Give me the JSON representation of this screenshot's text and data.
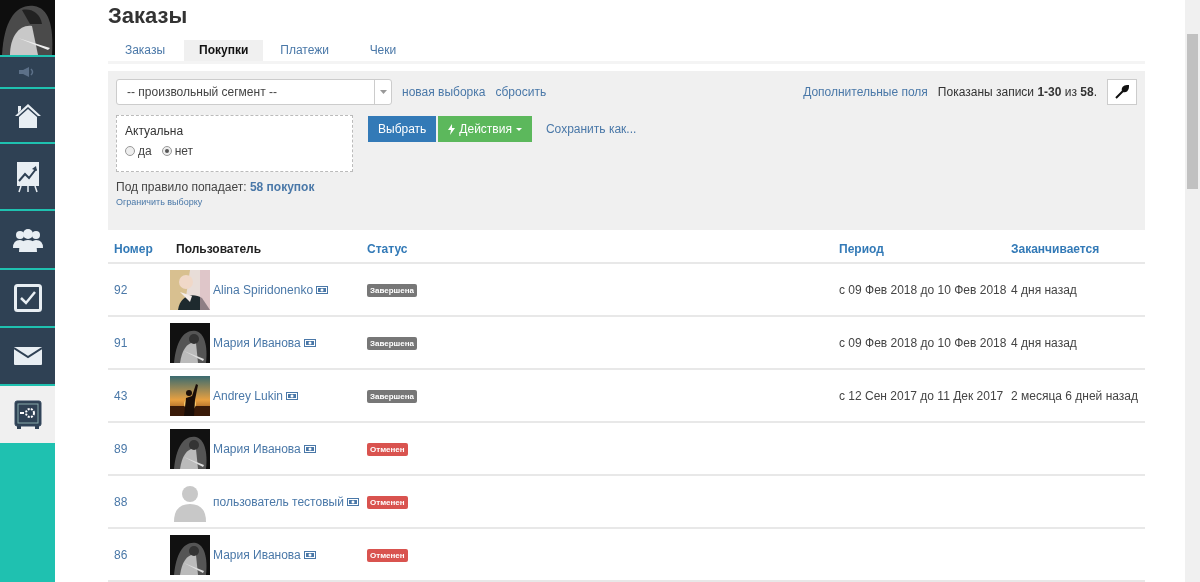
{
  "sidebar": {
    "items": [
      {
        "selected": false
      },
      {
        "selected": false
      },
      {
        "selected": false
      },
      {
        "selected": false
      },
      {
        "selected": false
      },
      {
        "selected": false
      },
      {
        "selected": true
      }
    ]
  },
  "title": "Заказы",
  "tabs": [
    {
      "label": "Заказы",
      "selected": false
    },
    {
      "label": "Покупки",
      "selected": true
    },
    {
      "label": "Платежи",
      "selected": false
    },
    {
      "label": "Чеки",
      "selected": false
    }
  ],
  "filter": {
    "segment_select": {
      "value": "-- произвольный сегмент --"
    },
    "links": [
      "новая выборка",
      "сбросить"
    ],
    "extra_fields_link": "Дополнительные поля",
    "records_info": "Показаны записи **1-30** из **58**.",
    "condition": {
      "label": "Актуальна",
      "options": [
        {
          "label": "да",
          "selected": false
        },
        {
          "label": "нет",
          "selected": true
        }
      ]
    },
    "select_button": "Выбрать",
    "actions_button": "Действия",
    "save_link": "Сохранить как...",
    "rule_info": {
      "text": "Под правило попадает:",
      "link": "58 покупок"
    },
    "limit_link": "Ограничить выборку"
  },
  "table": {
    "columns": [
      "Номер",
      "Пользователь",
      "Статус",
      "Период",
      "Заканчивается"
    ],
    "rows": [
      {
        "number": "92",
        "user": "Alina Spiridonenko",
        "status": "Завершена",
        "color": "#777777",
        "period": "с 09 Фев 2018 до 10 Фев 2018",
        "ends": "4 дня назад"
      },
      {
        "number": "91",
        "user": "Мария Иванова",
        "status": "Завершена",
        "color": "#777777",
        "period": "с 09 Фев 2018 до 10 Фев 2018",
        "ends": "4 дня назад"
      },
      {
        "number": "43",
        "user": "Andrey Lukin",
        "status": "Завершена",
        "color": "#777777",
        "period": "с 12 Сен 2017 до 11 Дек 2017",
        "ends": "2 месяца 6 дней назад"
      },
      {
        "number": "89",
        "user": "Мария Иванова",
        "status": "Отменен",
        "color": "#d9534f"
      },
      {
        "number": "88",
        "user": "пользователь тестовый",
        "avatar": {
          "kind": "placeholder"
        },
        "status": "Отменен",
        "color": "#d9534f"
      },
      {
        "number": "86",
        "user": "Мария Иванова",
        "status": "Отменен",
        "color": "#d9534f"
      }
    ]
  }
}
